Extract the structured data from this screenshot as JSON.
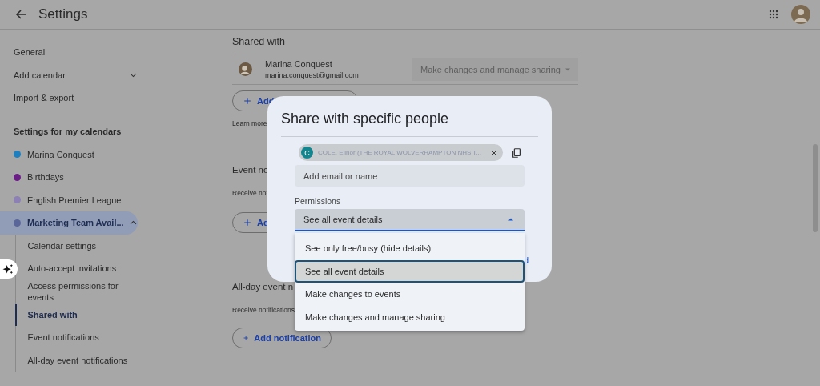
{
  "header": {
    "title": "Settings"
  },
  "sidebar": {
    "items": [
      {
        "kind": "link",
        "label": "General"
      },
      {
        "kind": "expander",
        "label": "Add calendar",
        "expanded": false
      },
      {
        "kind": "link",
        "label": "Import & export"
      },
      {
        "kind": "heading",
        "label": "Settings for my calendars"
      },
      {
        "kind": "calendar",
        "label": "Marina Conquest",
        "color": "#1d7fbf",
        "selected": false
      },
      {
        "kind": "calendar",
        "label": "Birthdays",
        "color": "#6b1d86",
        "selected": false
      },
      {
        "kind": "calendar",
        "label": "English Premier League",
        "color": "#8c80b4",
        "selected": false
      },
      {
        "kind": "calendar",
        "label": "Marketing Team Avail...",
        "color": "#5a6599",
        "selected": true,
        "expanded": true,
        "children": [
          {
            "label": "Calendar settings",
            "selected": false
          },
          {
            "label": "Auto-accept invitations",
            "selected": false
          },
          {
            "label": "Access permissions for events",
            "selected": false
          },
          {
            "label": "Shared with",
            "selected": true
          },
          {
            "label": "Event notifications",
            "selected": false
          },
          {
            "label": "All-day event notifications",
            "selected": false
          }
        ]
      }
    ]
  },
  "main": {
    "shared_heading": "Shared with",
    "person": {
      "name": "Marina Conquest",
      "email": "marina.conquest@gmail.com",
      "permission": "Make changes and manage sharing",
      "disabled": true
    },
    "add_button": "Add",
    "learn_more": "Learn more",
    "event_heading": "Event no",
    "event_text": "Receive not",
    "event_button": "Ad",
    "allday_heading": "All-day event n",
    "allday_text": "Receive notifications",
    "allday_button": "Add notification"
  },
  "dialog": {
    "title": "Share with specific people",
    "chip": {
      "initial": "C",
      "label": "COLE, Elinor (THE ROYAL WOLVERHAMPTON NHS T..."
    },
    "input": {
      "placeholder": "Add email or name"
    },
    "permissions_label": "Permissions",
    "select": {
      "value": "See all event details",
      "expanded": true
    },
    "options": [
      {
        "label": "See only free/busy (hide details)",
        "selected": false
      },
      {
        "label": "See all event details",
        "selected": true
      },
      {
        "label": "Make changes to events",
        "selected": false
      },
      {
        "label": "Make changes and manage sharing",
        "selected": false
      }
    ],
    "fragment": "d"
  }
}
